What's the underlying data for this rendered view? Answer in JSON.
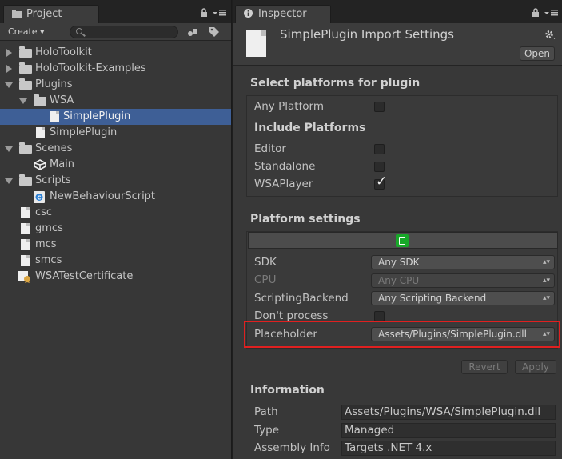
{
  "project_panel": {
    "tab_label": "Project",
    "create_label": "Create ▾",
    "search_placeholder": "",
    "tree": [
      {
        "label": "HoloToolkit",
        "type": "folder",
        "state": "closed",
        "depth": 0
      },
      {
        "label": "HoloToolkit-Examples",
        "type": "folder",
        "state": "closed",
        "depth": 0
      },
      {
        "label": "Plugins",
        "type": "folder",
        "state": "open",
        "depth": 0
      },
      {
        "label": "WSA",
        "type": "folder",
        "state": "open",
        "depth": 1
      },
      {
        "label": "SimplePlugin",
        "type": "file",
        "depth": 2,
        "selected": true
      },
      {
        "label": "SimplePlugin",
        "type": "file",
        "depth": 1
      },
      {
        "label": "Scenes",
        "type": "folder",
        "state": "open",
        "depth": 0
      },
      {
        "label": "Main",
        "type": "scene",
        "depth": 1
      },
      {
        "label": "Scripts",
        "type": "folder",
        "state": "open",
        "depth": 0
      },
      {
        "label": "NewBehaviourScript",
        "type": "script",
        "depth": 1
      },
      {
        "label": "csc",
        "type": "file",
        "depth": 0
      },
      {
        "label": "gmcs",
        "type": "file",
        "depth": 0
      },
      {
        "label": "mcs",
        "type": "file",
        "depth": 0
      },
      {
        "label": "smcs",
        "type": "file",
        "depth": 0
      },
      {
        "label": "WSATestCertificate",
        "type": "certificate",
        "depth": 0
      }
    ]
  },
  "inspector": {
    "tab_label": "Inspector",
    "title": "SimplePlugin Import Settings",
    "open_button": "Open",
    "select_platforms": {
      "heading": "Select platforms for plugin",
      "any_platform_label": "Any Platform",
      "any_platform_checked": false,
      "include_heading": "Include Platforms",
      "platforms": [
        {
          "label": "Editor",
          "checked": false
        },
        {
          "label": "Standalone",
          "checked": false
        },
        {
          "label": "WSAPlayer",
          "checked": true
        }
      ]
    },
    "platform_settings": {
      "heading": "Platform settings",
      "fields": [
        {
          "label": "SDK",
          "value": "Any SDK",
          "enabled": true
        },
        {
          "label": "CPU",
          "value": "Any CPU",
          "enabled": false
        },
        {
          "label": "ScriptingBackend",
          "value": "Any Scripting Backend",
          "enabled": true
        }
      ],
      "dont_process_label": "Don't process",
      "dont_process_checked": false,
      "placeholder_label": "Placeholder",
      "placeholder_value": "Assets/Plugins/SimplePlugin.dll"
    },
    "revert_button": "Revert",
    "apply_button": "Apply",
    "information": {
      "heading": "Information",
      "path_label": "Path",
      "path_value": "Assets/Plugins/WSA/SimplePlugin.dll",
      "type_label": "Type",
      "type_value": "Managed",
      "assembly_label": "Assembly Info",
      "assembly_value": "Targets .NET 4.x"
    }
  },
  "colors": {
    "selection": "#3e5f96",
    "highlight_box": "#e02020",
    "wsa_icon": "#18a829"
  }
}
